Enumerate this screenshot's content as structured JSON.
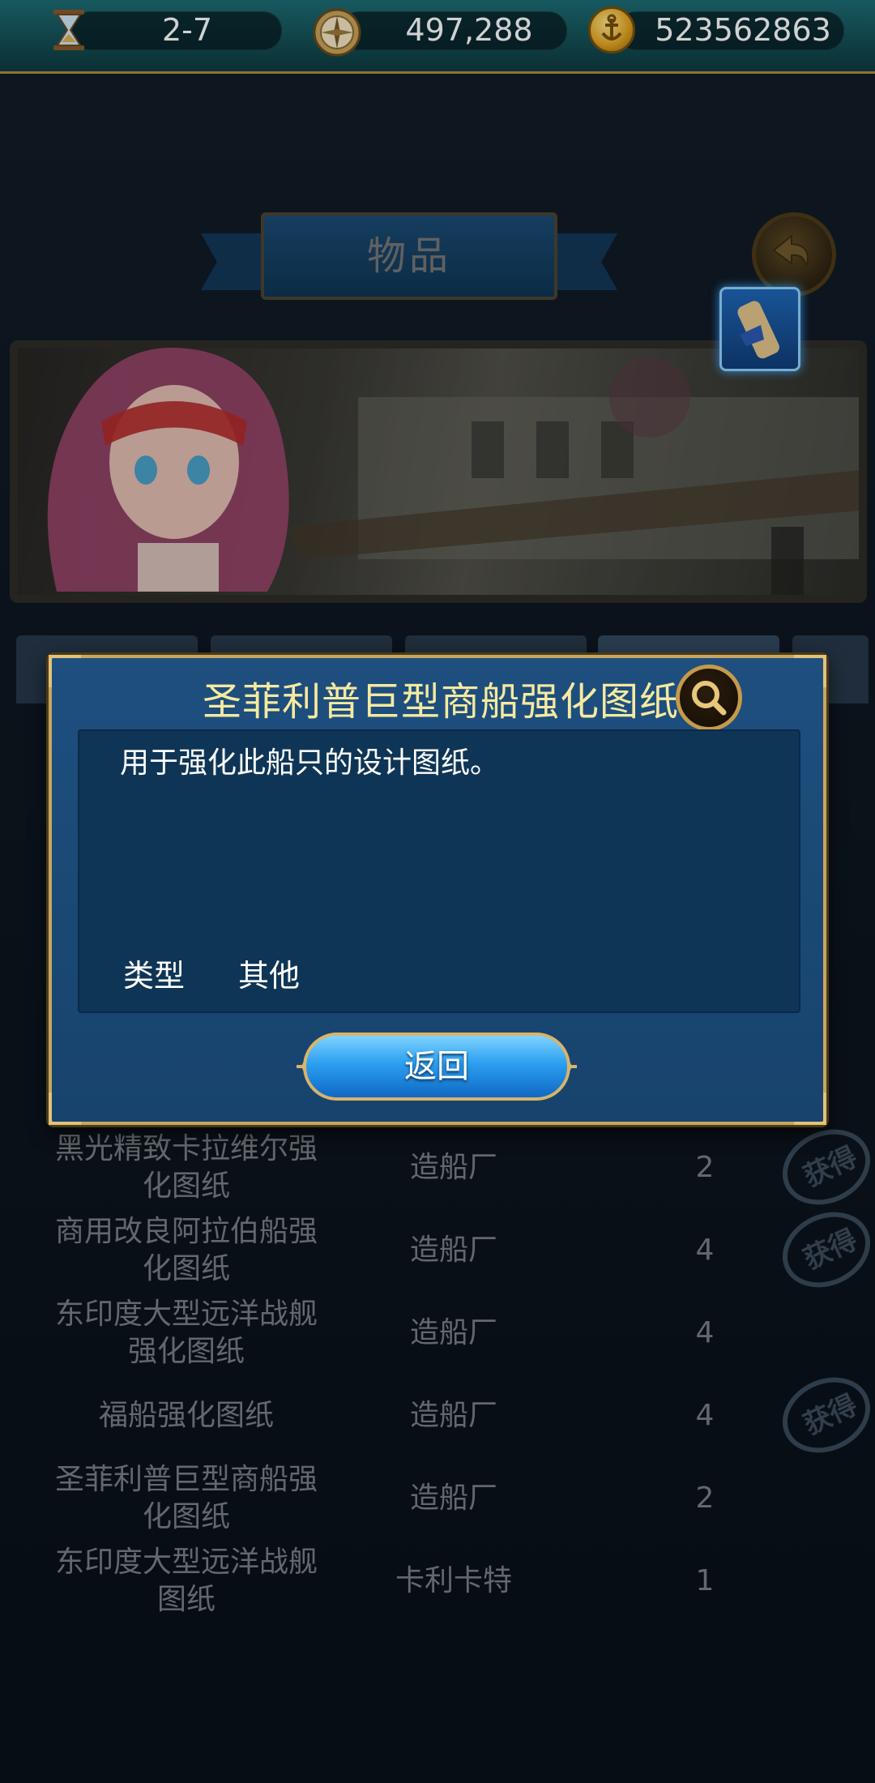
{
  "topbar": {
    "stage": "2-7",
    "silver": "497,288",
    "gold": "523562863"
  },
  "page": {
    "title": "物品"
  },
  "list": {
    "rows": [
      {
        "name": "黑光精致卡拉维尔强化图纸",
        "source": "造船厂",
        "count": "2",
        "stamp": "获得"
      },
      {
        "name": "商用改良阿拉伯船强化图纸",
        "source": "造船厂",
        "count": "4",
        "stamp": "获得"
      },
      {
        "name": "东印度大型远洋战舰强化图纸",
        "source": "造船厂",
        "count": "4",
        "stamp": ""
      },
      {
        "name": "福船强化图纸",
        "source": "造船厂",
        "count": "4",
        "stamp": "获得"
      },
      {
        "name": "圣菲利普巨型商船强化图纸",
        "source": "造船厂",
        "count": "2",
        "stamp": ""
      },
      {
        "name": "东印度大型远洋战舰图纸",
        "source": "卡利卡特",
        "count": "1",
        "stamp": ""
      }
    ]
  },
  "dialog": {
    "title": "圣菲利普巨型商船强化图纸",
    "description": "用于强化此船只的设计图纸。",
    "type_label": "类型",
    "type_value": "其他",
    "back_label": "返回"
  },
  "colors": {
    "dialog_border": "#c7a663",
    "dialog_title": "#f6eaa0",
    "button_blue": "#2b9ff0"
  }
}
